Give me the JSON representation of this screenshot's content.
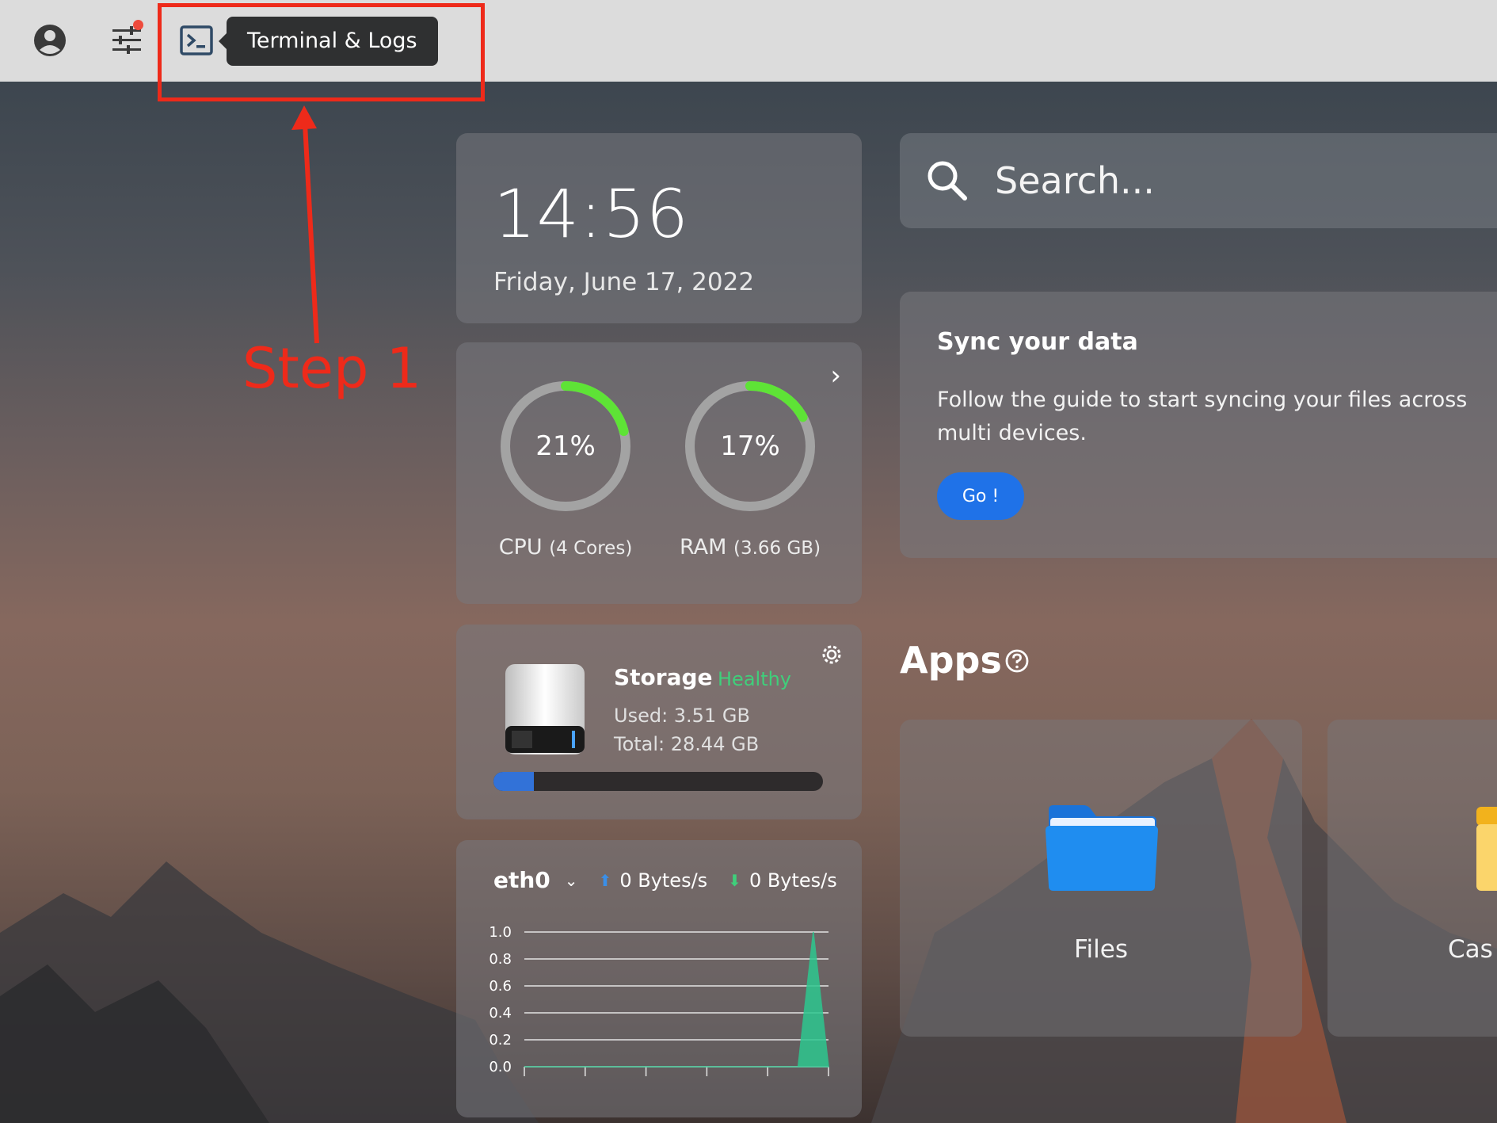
{
  "topbar": {
    "tooltip": "Terminal & Logs",
    "icons": [
      "account-circle-icon",
      "settings-sliders-icon",
      "terminal-icon"
    ],
    "notification_dot_color": "#ee4b3c"
  },
  "annotation": {
    "step_label": "Step 1",
    "color": "#ee2a1a"
  },
  "clock": {
    "time": "14:56",
    "date": "Friday, June 17, 2022"
  },
  "system": {
    "cpu": {
      "percent_label": "21%",
      "label": "CPU",
      "detail": "(4 Cores)",
      "value": 0.21
    },
    "ram": {
      "percent_label": "17%",
      "label": "RAM",
      "detail": "(3.66 GB)",
      "value": 0.17
    }
  },
  "storage": {
    "title": "Storage",
    "status": "Healthy",
    "used": "Used: 3.51 GB",
    "total": "Total: 28.44 GB",
    "used_fraction": 0.123
  },
  "network": {
    "interface": "eth0",
    "upload": "0 Bytes/s",
    "download": "0 Bytes/s",
    "chart_data": {
      "type": "area",
      "y_ticks": [
        "1.0",
        "0.8",
        "0.6",
        "0.4",
        "0.2",
        "0.0"
      ],
      "ylim": [
        0,
        1
      ],
      "series": [
        {
          "values": [
            0,
            0,
            0,
            0,
            0,
            0,
            0,
            0,
            0,
            0,
            0,
            0,
            0,
            0,
            0,
            0,
            0,
            0,
            0,
            1,
            0
          ]
        }
      ],
      "fill_color": "#2dc78f"
    }
  },
  "search": {
    "placeholder": "Search..."
  },
  "sync": {
    "title": "Sync your data",
    "body": "Follow the guide to start syncing your files across multi devices.",
    "button": "Go !"
  },
  "apps": {
    "title": "Apps",
    "items": [
      {
        "name": "Files",
        "icon": "folder-icon"
      },
      {
        "name": "Cas",
        "icon": "casaos-icon"
      }
    ]
  },
  "colors": {
    "accent": "#1f72e8",
    "gauge_green": "#5ee336",
    "healthy": "#3fcf7b"
  }
}
